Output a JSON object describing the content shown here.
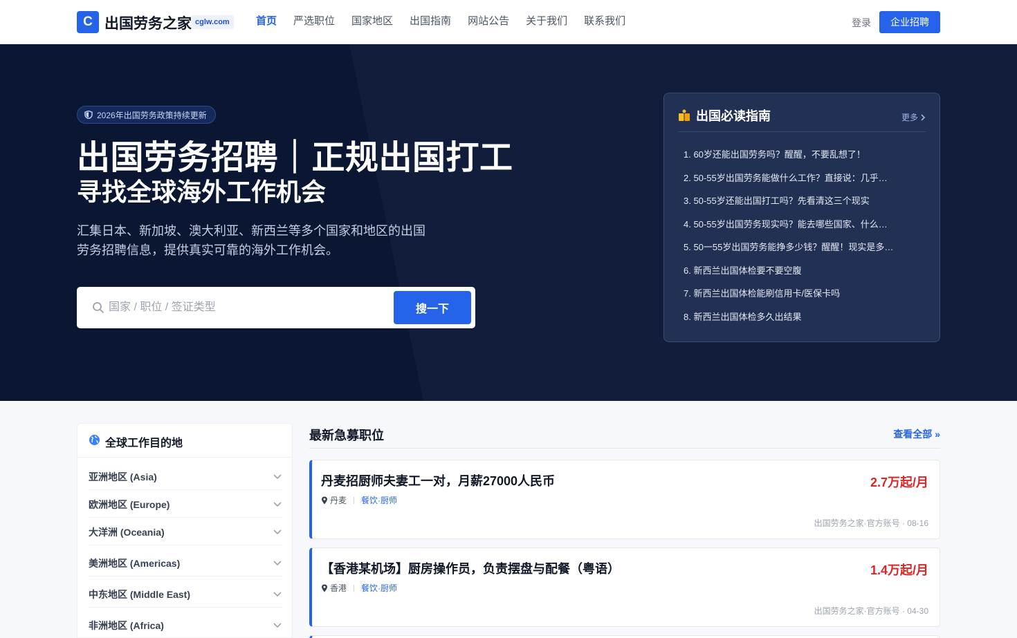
{
  "header": {
    "logo_letter": "C",
    "logo_text": "出国劳务之家",
    "logo_domain": "cglw.com",
    "nav": [
      "首页",
      "严选职位",
      "国家地区",
      "出国指南",
      "网站公告",
      "关于我们",
      "联系我们"
    ],
    "login": "登录",
    "recruit_button": "企业招聘"
  },
  "hero": {
    "badge": "2026年出国劳务政策持续更新",
    "title": "出国劳务招聘｜正规出国打工",
    "subtitle": "寻找全球海外工作机会",
    "description": "汇集日本、新加坡、澳大利亚、新西兰等多个国家和地区的出国劳务招聘信息，提供真实可靠的海外工作机会。",
    "search_placeholder": "国家 / 职位 / 签证类型",
    "search_button": "搜一下"
  },
  "guide": {
    "title": "出国必读指南",
    "more": "更多",
    "items": [
      "1. 60岁还能出国劳务吗？醒醒，不要乱想了！",
      "2. 50-55岁出国劳务能做什么工作？直接说：几乎…",
      "3. 50-55岁还能出国打工吗？先看清这三个现实",
      "4. 50-55岁出国劳务现实吗？能去哪些国家、什么…",
      "5. 50一55岁出国劳务能挣多少钱？醒醒！现实是多…",
      "6. 新西兰出国体检要不要空腹",
      "7. 新西兰出国体检能刷信用卡/医保卡吗",
      "8. 新西兰出国体检多久出结果"
    ]
  },
  "destinations": {
    "title": "全球工作目的地",
    "regions": [
      "亚洲地区 (Asia)",
      "欧洲地区 (Europe)",
      "大洋洲 (Oceania)",
      "美洲地区 (Americas)",
      "中东地区 (Middle East)",
      "非洲地区 (Africa)"
    ]
  },
  "jobs": {
    "title": "最新急募职位",
    "view_all": "查看全部 »",
    "items": [
      {
        "title": "丹麦招厨师夫妻工一对，月薪27000人民币",
        "salary": "2.7万起/月",
        "location": "丹麦",
        "category": "餐饮·厨师",
        "footer": "出国劳务之家·官方账号 · 08-16"
      },
      {
        "title": "【香港某机场】厨房操作员，负责摆盘与配餐（粤语）",
        "salary": "1.4万起/月",
        "location": "香港",
        "category": "餐饮·厨师",
        "footer": "出国劳务之家·官方账号 · 04-30"
      }
    ]
  },
  "colors": {
    "primary": "#2563eb",
    "salary": "#dc2626",
    "hero_bg": "#0b1633"
  }
}
